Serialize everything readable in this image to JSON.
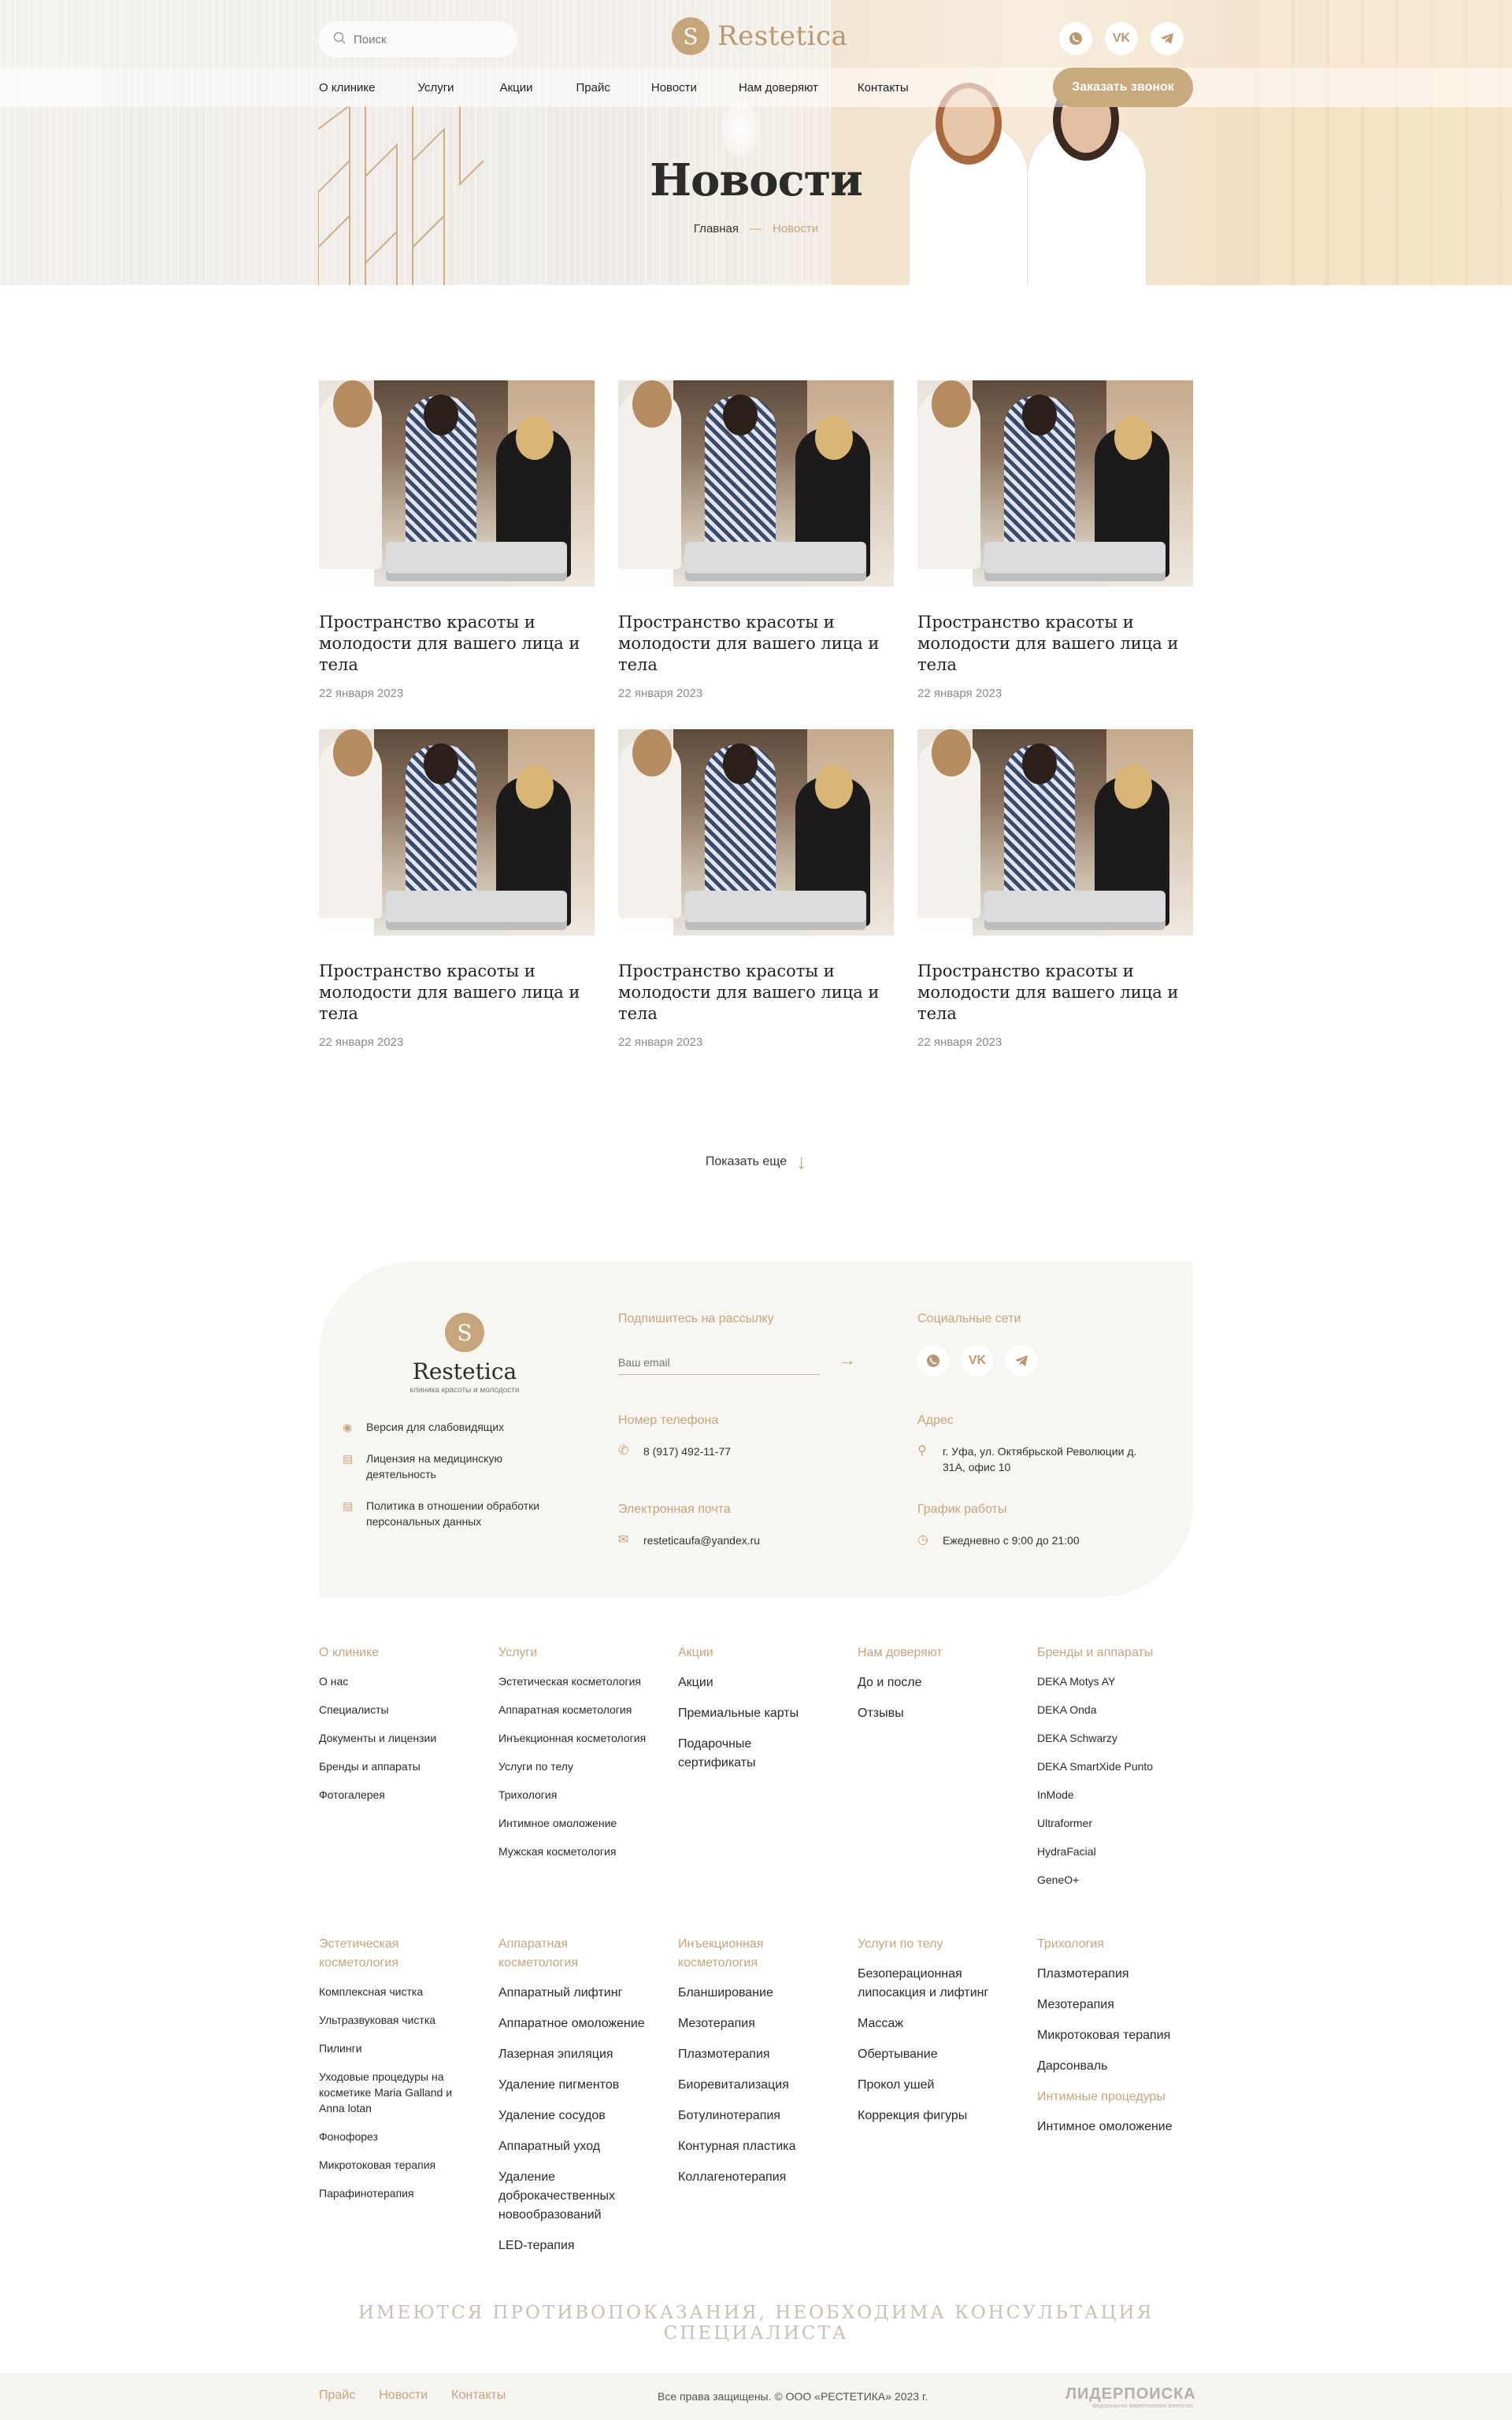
{
  "header": {
    "search_placeholder": "Поиск",
    "logo_text": "Restetica",
    "socials": [
      "whatsapp-icon",
      "vk-icon",
      "telegram-icon"
    ],
    "nav": [
      "О клинике",
      "Услуги",
      "Акции",
      "Прайс",
      "Новости",
      "Нам доверяют",
      "Контакты"
    ],
    "call_button": "Заказать звонок"
  },
  "hero": {
    "title": "Новости",
    "breadcrumb_home": "Главная",
    "breadcrumb_sep": "—",
    "breadcrumb_current": "Новости"
  },
  "news": [
    {
      "title": "Пространство красоты и молодости для вашего лица и тела",
      "date": "22 января 2023"
    },
    {
      "title": "Пространство красоты и молодости для вашего лица и тела",
      "date": "22 января 2023"
    },
    {
      "title": "Пространство красоты и молодости для вашего лица и тела",
      "date": "22 января 2023"
    },
    {
      "title": "Пространство красоты и молодости для вашего лица и тела",
      "date": "22 января 2023"
    },
    {
      "title": "Пространство красоты и молодости для вашего лица и тела",
      "date": "22 января 2023"
    },
    {
      "title": "Пространство красоты и молодости для вашего лица и тела",
      "date": "22 января 2023"
    }
  ],
  "show_more": "Показать еще",
  "footer": {
    "logo_name": "Restetica",
    "logo_sub": "клиника красоты и молодости",
    "links": [
      "Версия для слабовидящих",
      "Лицензия на медицинскую деятельность",
      "Политика в отношении обработки персональных данных"
    ],
    "subscribe_label": "Подпишитесь на рассылку",
    "email_placeholder": "Ваш email",
    "socials_label": "Социальные сети",
    "phone_label": "Номер телефона",
    "phone": "8 (917) 492-11-77",
    "address_label": "Адрес",
    "address": "г. Уфа, ул. Октябрьской Революции д. 31А, офис 10",
    "email_label": "Электронная почта",
    "email": "resteticaufa@yandex.ru",
    "hours_label": "График работы",
    "hours": "Ежедневно с 9:00 до 21:00"
  },
  "sitemap_top": [
    {
      "title": "О клинике",
      "items": [
        "О нас",
        "Специалисты",
        "Документы и лицензии",
        "Бренды и аппараты",
        "Фотогалерея"
      ]
    },
    {
      "title": "Услуги",
      "items": [
        "Эстетическая косметология",
        "Аппаратная косметология",
        "Инъекционная косметология",
        "Услуги по телу",
        "Трихология",
        "Интимное омоложение",
        "Мужская косметология"
      ]
    },
    {
      "title": "Акции",
      "items": [
        "Акции",
        "Премиальные карты",
        "Подарочные сертификаты"
      ]
    },
    {
      "title": "Нам доверяют",
      "items": [
        "До и после",
        "Отзывы"
      ]
    },
    {
      "title": "Бренды и аппараты",
      "items": [
        "DEKA Motys AY",
        "DEKA Onda",
        "DEKA Schwarzy",
        "DEKA SmartXide Punto",
        "InMode",
        "Ultraformer",
        "HydraFacial",
        "GeneO+"
      ]
    }
  ],
  "sitemap_bottom": [
    {
      "title": "Эстетическая косметология",
      "items": [
        "Комплексная чистка",
        "Ультразвуковая чистка",
        "Пилинги",
        "Уходовые процедуры на косметике Maria Galland и Anna lotan",
        "Фонофорез",
        "Микротоковая терапия",
        "Парафинотерапия"
      ]
    },
    {
      "title": "Аппаратная косметология",
      "items": [
        "Аппаратный лифтинг",
        "Аппаратное омоложение",
        "Лазерная эпиляция",
        "Удаление пигментов",
        "Удаление сосудов",
        "Аппаратный уход",
        "Удаление доброкачественных новообразований",
        "LED-терапия"
      ]
    },
    {
      "title": "Инъекционная косметология",
      "items": [
        "Бланширование",
        "Мезотерапия",
        "Плазмотерапия",
        "Биоревитализация",
        "Ботулинотерапия",
        "Контурная пластика",
        "Коллагенотерапия"
      ]
    },
    {
      "title": "Услуги по телу",
      "items": [
        "Безоперационная липосакция и лифтинг",
        "Массаж",
        "Обертывание",
        "Прокол ушей",
        "Коррекция фигуры"
      ]
    },
    {
      "title": "Трихология",
      "items": [
        "Плазмотерапия",
        "Мезотерапия",
        "Микротоковая терапия",
        "Дарсонваль"
      ],
      "title2": "Интимные процедуры",
      "items2": [
        "Интимное омоложение"
      ]
    }
  ],
  "disclaimer": "ИМЕЮТСЯ ПРОТИВОПОКАЗАНИЯ, НЕОБХОДИМА КОНСУЛЬТАЦИЯ СПЕЦИАЛИСТА",
  "bottom": {
    "links": [
      "Прайс",
      "Новости",
      "Контакты"
    ],
    "copyright": "Все права защищены. © ООО «РЕСТЕТИКА» 2023 г.",
    "developer": "ЛИДЕРПОИСКА",
    "developer_sub": "федеральное маркетинговое агентство"
  }
}
